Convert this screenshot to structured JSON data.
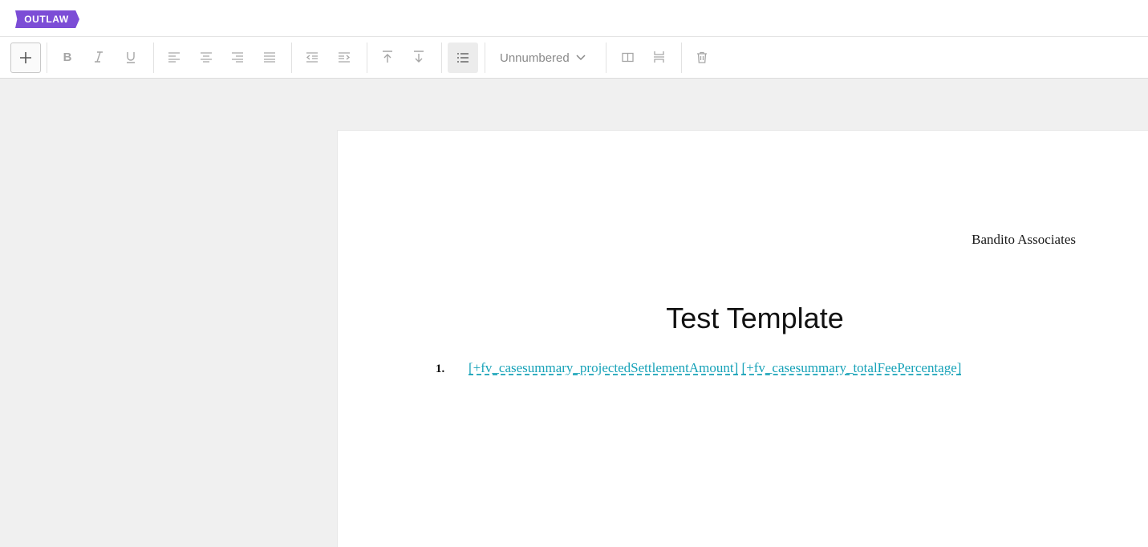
{
  "app": {
    "logo_text": "OUTLAW",
    "brand_color": "#7c4dd6"
  },
  "toolbar": {
    "buttons": [
      {
        "name": "add",
        "icon": "plus-icon"
      },
      {
        "name": "bold",
        "icon": "bold-icon",
        "label": "B"
      },
      {
        "name": "italic",
        "icon": "italic-icon",
        "label": "I"
      },
      {
        "name": "underline",
        "icon": "underline-icon",
        "label": "U"
      },
      {
        "name": "align-left",
        "icon": "align-left-icon"
      },
      {
        "name": "align-center",
        "icon": "align-center-icon"
      },
      {
        "name": "align-right",
        "icon": "align-right-icon"
      },
      {
        "name": "align-justify",
        "icon": "align-justify-icon"
      },
      {
        "name": "outdent",
        "icon": "outdent-icon"
      },
      {
        "name": "indent",
        "icon": "indent-icon"
      },
      {
        "name": "move-up",
        "icon": "arrow-up-icon"
      },
      {
        "name": "move-down",
        "icon": "arrow-down-icon"
      },
      {
        "name": "list",
        "icon": "list-icon",
        "active": true
      },
      {
        "name": "columns",
        "icon": "columns-icon"
      },
      {
        "name": "page-break",
        "icon": "page-break-icon"
      },
      {
        "name": "delete",
        "icon": "trash-icon"
      }
    ],
    "numbering_select": {
      "value": "Unnumbered"
    }
  },
  "document": {
    "header_text": "Bandito Associates",
    "title": "Test Template",
    "list": [
      {
        "number": "1.",
        "fields": [
          "[+fv_casesummary_projectedSettlementAmount]",
          "[+fv_casesummary_totalFeePercentage]"
        ]
      }
    ],
    "field_color": "#17a2b8"
  }
}
